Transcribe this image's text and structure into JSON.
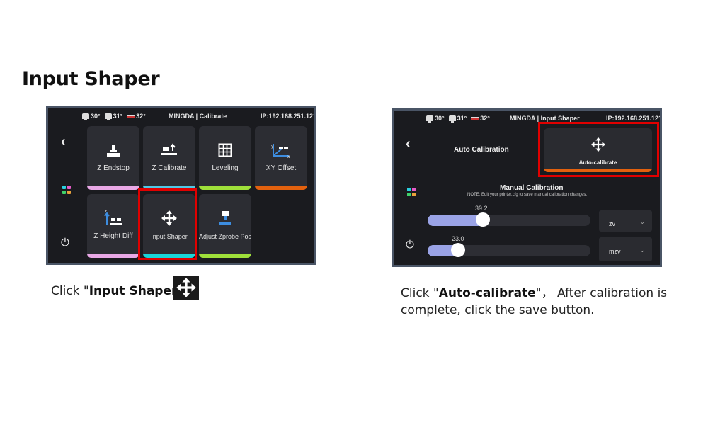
{
  "page": {
    "title": "Input Shaper"
  },
  "screen1": {
    "status": {
      "temps": [
        "30°",
        "31°",
        "32°"
      ],
      "title": "MINGDA | Calibrate",
      "ip": "IP:192.168.251.121"
    },
    "tiles": [
      {
        "label": "Z Endstop",
        "icon": "z-endstop-icon",
        "bar_color": "#e9a8e6"
      },
      {
        "label": "Z Calibrate",
        "icon": "z-calibrate-icon",
        "bar_color": "#4ec8e6"
      },
      {
        "label": "Leveling",
        "icon": "grid-icon",
        "bar_color": "#9fe03a"
      },
      {
        "label": "XY Offset",
        "icon": "xy-offset-icon",
        "bar_color": "#e3610e"
      },
      {
        "label": "Z Height Diff",
        "icon": "z-height-diff-icon",
        "bar_color": "#e9a8e6"
      },
      {
        "label": "Input Shaper",
        "icon": "move-arrows-icon",
        "bar_color": "#19d4d8"
      },
      {
        "label": "Adjust Zprobe Pos",
        "icon": "zprobe-icon",
        "bar_color": "#9fe03a"
      }
    ]
  },
  "screen2": {
    "status": {
      "temps": [
        "30°",
        "31°",
        "32°"
      ],
      "title": "MINGDA | Input Shaper",
      "ip": "IP:192.168.251.121"
    },
    "auto_title": "Auto Calibration",
    "auto_button": "Auto-calibrate",
    "manual_title": "Manual Calibration",
    "manual_note": "NOTE: Edit your printer.cfg to save manual calibration changes.",
    "sliders": [
      {
        "value_label": "39.2",
        "fraction": 0.32,
        "shaper": "zv"
      },
      {
        "value_label": "23.0",
        "fraction": 0.17,
        "shaper": "mzv"
      }
    ]
  },
  "captions": {
    "left_prefix": "Click \"",
    "left_bold": "Input Shaper",
    "left_suffix": "\"",
    "right_prefix": "Click \"",
    "right_bold": "Auto-calibrate",
    "right_suffix": "\"，  After calibration is",
    "right_line2": "complete, click the save button."
  },
  "colors": {
    "highlight": "#e00000",
    "screen_bg": "#1a1b1f",
    "tile_bg": "#2c2d33",
    "slider_fill": "#9aa3e6",
    "auto_bar": "#e3610e"
  }
}
